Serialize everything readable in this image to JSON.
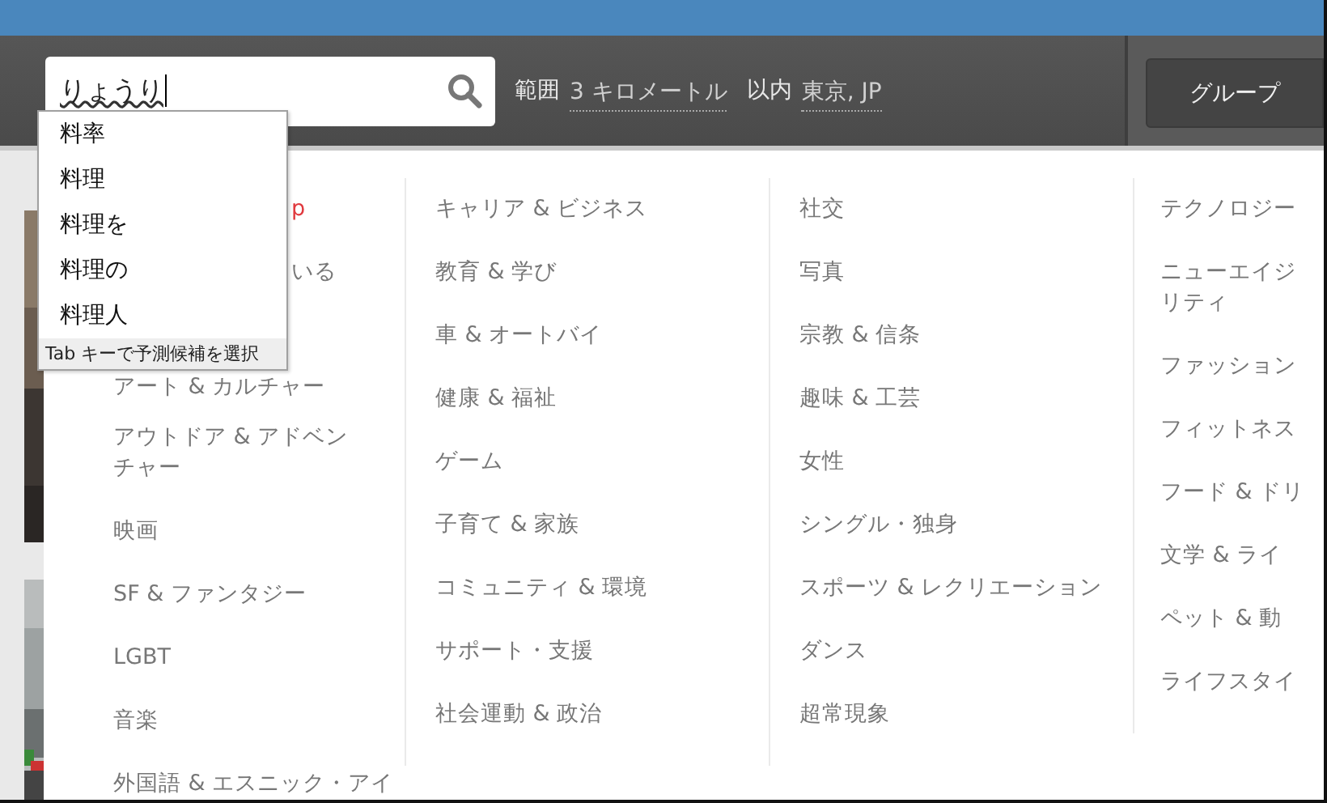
{
  "search": {
    "value": "りょうり",
    "composing": true
  },
  "location": {
    "range_label": "範囲",
    "distance": "3 キロメートル",
    "within_label": "以内",
    "city": "東京, JP"
  },
  "group_button": "グループ",
  "suggestions": {
    "items": [
      "料率",
      "料理",
      "料理を",
      "料理の",
      "料理人"
    ],
    "hint": "Tab キーで予測候補を選択"
  },
  "columns": [
    [
      {
        "lines": [
          "p"
        ],
        "kind": "featured"
      },
      {
        "lines": [
          "いる"
        ],
        "kind": "partial"
      },
      {
        "lines": [
          "アート & カルチャー"
        ],
        "kind": "topic"
      },
      {
        "lines": [
          "アウトドア & アドベン",
          "チャー"
        ],
        "kind": "topic"
      },
      {
        "lines": [
          "映画"
        ],
        "kind": "topic"
      },
      {
        "lines": [
          "SF & ファンタジー"
        ],
        "kind": "topic"
      },
      {
        "lines": [
          "LGBT"
        ],
        "kind": "topic"
      },
      {
        "lines": [
          "音楽"
        ],
        "kind": "topic"
      },
      {
        "lines": [
          "外国語 & エスニック・アイ"
        ],
        "kind": "topic"
      }
    ],
    [
      {
        "lines": [
          "キャリア & ビジネス"
        ],
        "kind": "topic"
      },
      {
        "lines": [
          "教育 & 学び"
        ],
        "kind": "topic"
      },
      {
        "lines": [
          "車 & オートバイ"
        ],
        "kind": "topic"
      },
      {
        "lines": [
          "健康 & 福祉"
        ],
        "kind": "topic"
      },
      {
        "lines": [
          "ゲーム"
        ],
        "kind": "topic"
      },
      {
        "lines": [
          "子育て & 家族"
        ],
        "kind": "topic"
      },
      {
        "lines": [
          "コミュニティ & 環境"
        ],
        "kind": "topic"
      },
      {
        "lines": [
          "サポート・支援"
        ],
        "kind": "topic"
      },
      {
        "lines": [
          "社会運動 & 政治"
        ],
        "kind": "topic"
      }
    ],
    [
      {
        "lines": [
          "社交"
        ],
        "kind": "topic"
      },
      {
        "lines": [
          "写真"
        ],
        "kind": "topic"
      },
      {
        "lines": [
          "宗教 & 信条"
        ],
        "kind": "topic"
      },
      {
        "lines": [
          "趣味 & 工芸"
        ],
        "kind": "topic"
      },
      {
        "lines": [
          "女性"
        ],
        "kind": "topic"
      },
      {
        "lines": [
          "シングル・独身"
        ],
        "kind": "topic"
      },
      {
        "lines": [
          "スポーツ & レクリエーション"
        ],
        "kind": "topic"
      },
      {
        "lines": [
          "ダンス"
        ],
        "kind": "topic"
      },
      {
        "lines": [
          "超常現象"
        ],
        "kind": "topic"
      }
    ],
    [
      {
        "lines": [
          "テクノロジー"
        ],
        "kind": "topic"
      },
      {
        "lines": [
          "ニューエイジ",
          "リティ"
        ],
        "kind": "topic"
      },
      {
        "lines": [
          "ファッション"
        ],
        "kind": "topic"
      },
      {
        "lines": [
          "フィットネス"
        ],
        "kind": "topic"
      },
      {
        "lines": [
          "フード & ドリ"
        ],
        "kind": "topic"
      },
      {
        "lines": [
          "文学 & ライ"
        ],
        "kind": "topic"
      },
      {
        "lines": [
          "ペット & 動"
        ],
        "kind": "topic"
      },
      {
        "lines": [
          "ライフスタイ"
        ],
        "kind": "topic"
      }
    ]
  ]
}
